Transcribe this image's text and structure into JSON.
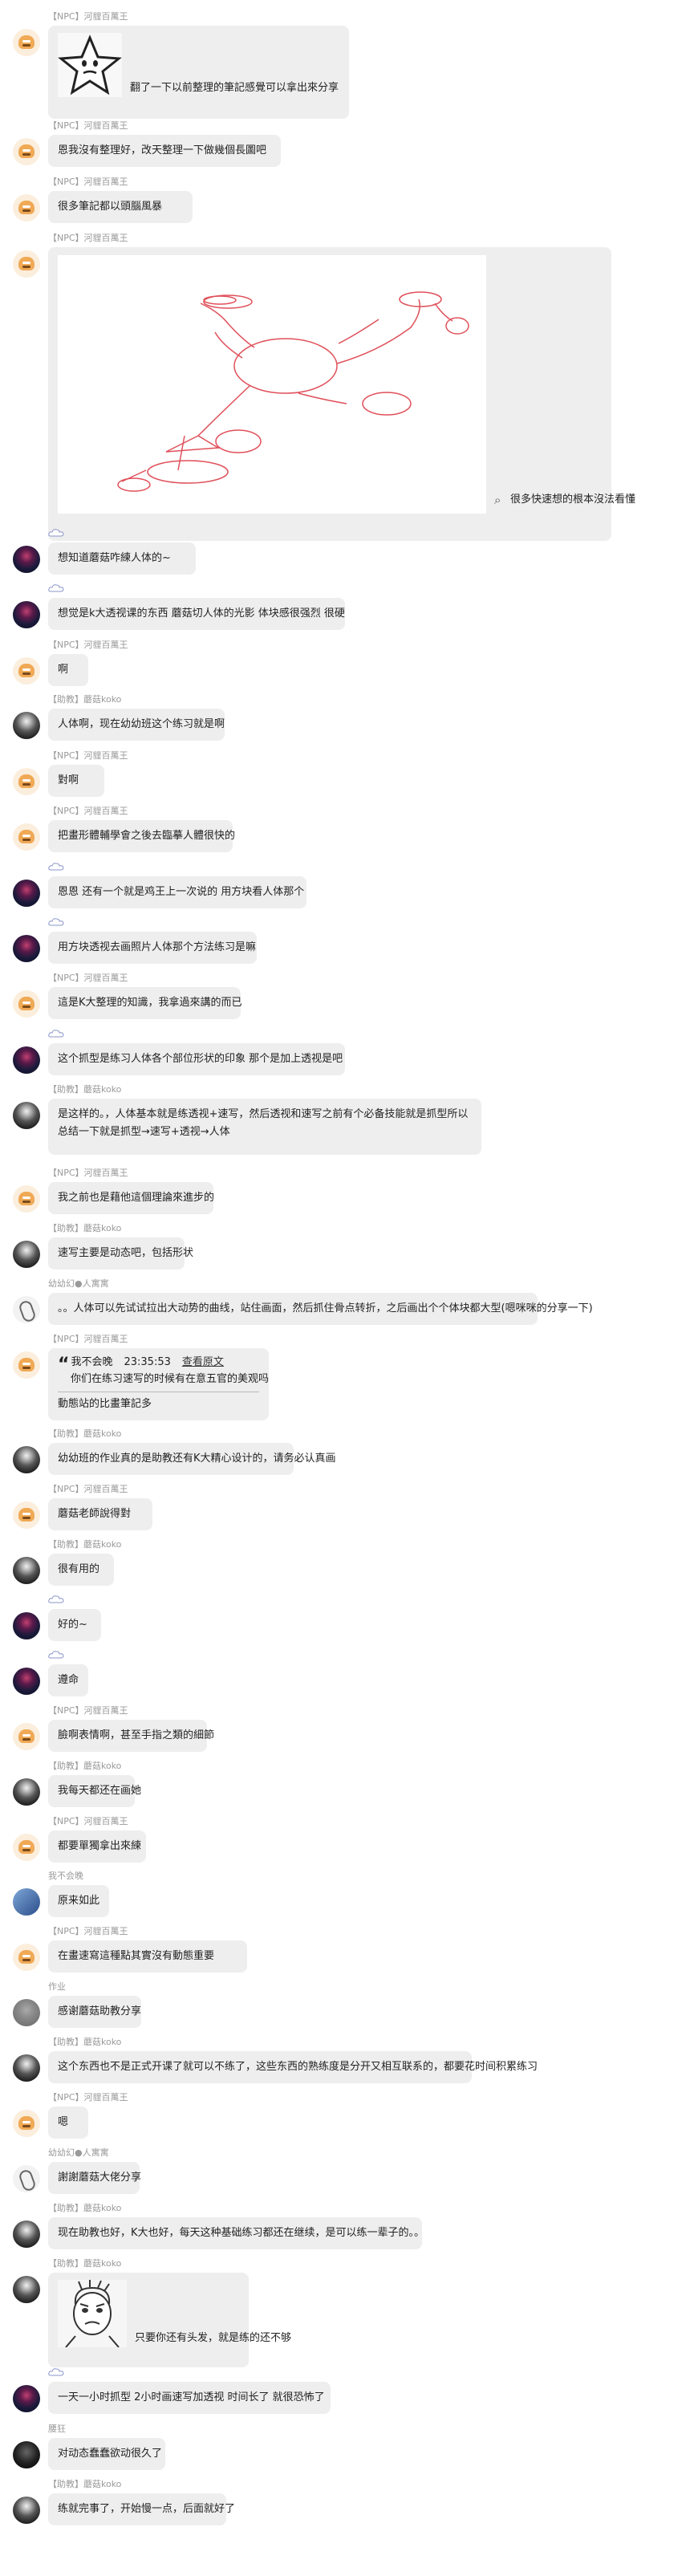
{
  "messages": [
    {
      "sender": "【NPC】河貍百萬王",
      "avatar": "npc",
      "text": "翻了一下以前整理的筆記感覺可以拿出來分享",
      "image": "star-sticker"
    },
    {
      "sender": "【NPC】河貍百萬王",
      "avatar": "npc",
      "text": "恩我沒有整理好，改天整理一下做幾個長圖吧"
    },
    {
      "sender": "【NPC】河貍百萬王",
      "avatar": "npc",
      "text": "很多筆記都以頭腦風暴"
    },
    {
      "sender": "【NPC】河貍百萬王",
      "avatar": "npc",
      "text": "很多快速想的根本沒法看懂",
      "image": "sketch"
    },
    {
      "sender": "",
      "avatar": "purple",
      "text": "想知道蘑菇咋練人体的~"
    },
    {
      "sender": "",
      "avatar": "purple",
      "text": "想觉是k大透视课的东西 蘑菇切人体的光影 体块感很强烈 很硬"
    },
    {
      "sender": "【NPC】河貍百萬王",
      "avatar": "npc",
      "text": "啊"
    },
    {
      "sender": "【助教】蘑菇koko",
      "avatar": "koko",
      "text": "人体啊，现在幼幼班这个练习就是啊"
    },
    {
      "sender": "【NPC】河貍百萬王",
      "avatar": "npc",
      "text": "對啊"
    },
    {
      "sender": "【NPC】河貍百萬王",
      "avatar": "npc",
      "text": "把畫形體輔學會之後去臨摹人體很快的"
    },
    {
      "sender": "",
      "avatar": "purple",
      "text": "恩恩 还有一个就是鸡王上一次说的 用方块看人体那个"
    },
    {
      "sender": "",
      "avatar": "purple",
      "text": "用方块透视去画照片人体那个方法练习是嘛"
    },
    {
      "sender": "【NPC】河貍百萬王",
      "avatar": "npc",
      "text": "這是K大整理的知識，我拿過來講的而已"
    },
    {
      "sender": "",
      "avatar": "purple",
      "text": "这个抓型是练习人体各个部位形状的印象  那个是加上透视是吧"
    },
    {
      "sender": "【助教】蘑菇koko",
      "avatar": "koko",
      "text": "是这样的。，人体基本就是练透视+速写，然后透视和速写之前有个必备技能就是抓型所以总结一下就是抓型→速写+透视→人体"
    },
    {
      "sender": "【NPC】河貍百萬王",
      "avatar": "npc",
      "text": "我之前也是藉他這個理論來進步的"
    },
    {
      "sender": "【助教】蘑菇koko",
      "avatar": "koko",
      "text": "速写主要是动态吧，包括形状"
    },
    {
      "sender": "幼幼幻●人寓寓",
      "avatar": "fan",
      "text": "。。人体可以先试试拉出大动势的曲线，站住画面，然后抓住骨点转折，之后画出个个体块都大型(嗯咪咪的分享一下)"
    },
    {
      "sender": "【NPC】河貍百萬王",
      "avatar": "npc",
      "quote": {
        "who": "我不会晚",
        "time": "23:35:53",
        "link": "查看原文",
        "text": "你们在练习速写的时候有在意五官的美观吗"
      },
      "text": "動態站的比畫筆記多"
    },
    {
      "sender": "【助教】蘑菇koko",
      "avatar": "koko",
      "text": "幼幼班的作业真的是助教还有K大精心设计的，请务必认真画"
    },
    {
      "sender": "【NPC】河貍百萬王",
      "avatar": "npc",
      "text": "蘑菇老師說得對"
    },
    {
      "sender": "【助教】蘑菇koko",
      "avatar": "koko",
      "text": "很有用的"
    },
    {
      "sender": "",
      "avatar": "purple",
      "text": "好的~"
    },
    {
      "sender": "",
      "avatar": "purple",
      "text": "遵命"
    },
    {
      "sender": "【NPC】河貍百萬王",
      "avatar": "npc",
      "text": "臉啊表情啊，甚至手指之類的細節"
    },
    {
      "sender": "【助教】蘑菇koko",
      "avatar": "koko",
      "text": "我每天都还在画她"
    },
    {
      "sender": "【NPC】河貍百萬王",
      "avatar": "npc",
      "text": "都要單獨拿出來練"
    },
    {
      "sender": "我不会晚",
      "avatar": "blue",
      "text": "原来如此"
    },
    {
      "sender": "【NPC】河貍百萬王",
      "avatar": "npc",
      "text": "在畫速寫這種點其實沒有動態重要"
    },
    {
      "sender": "作业",
      "avatar": "grey",
      "text": "感谢蘑菇助教分享"
    },
    {
      "sender": "【助教】蘑菇koko",
      "avatar": "koko",
      "text": "这个东西也不是正式开课了就可以不练了，这些东西的熟练度是分开又相互联系的，都要花时间积累练习"
    },
    {
      "sender": "【NPC】河貍百萬王",
      "avatar": "npc",
      "text": "嗯"
    },
    {
      "sender": "幼幼幻●人寓寓",
      "avatar": "fan",
      "text": "謝謝蘑菇大佬分享"
    },
    {
      "sender": "【助教】蘑菇koko",
      "avatar": "koko",
      "text": "现在助教也好，K大也好，每天这种基础练习都还在继续，是可以练一辈子的。。"
    },
    {
      "sender": "【助教】蘑菇koko",
      "avatar": "koko",
      "text": "只要你还有头发，就是练的还不够",
      "image": "face-sticker"
    },
    {
      "sender": "",
      "avatar": "purple",
      "text": "一天一小时抓型 2小时画速写加透视   时间长了  就很恐怖了"
    },
    {
      "sender": "腰狂",
      "avatar": "dark",
      "text": "对动态蠢蠢欲动很久了"
    },
    {
      "sender": "【助教】蘑菇koko",
      "avatar": "koko",
      "text": "练就完事了，开始慢一点，后面就好了"
    }
  ]
}
